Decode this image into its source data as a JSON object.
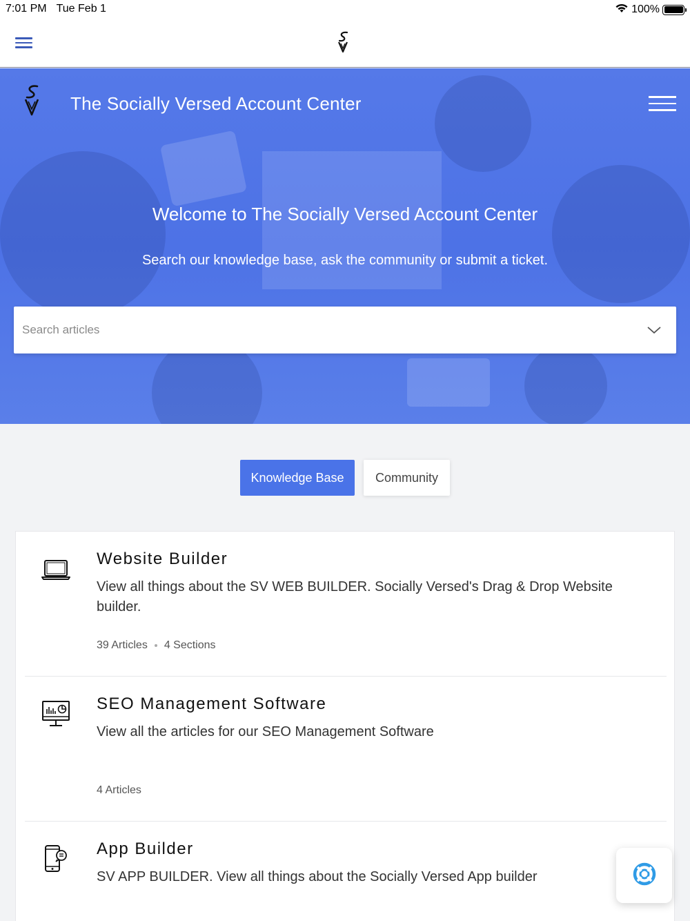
{
  "status_bar": {
    "time": "7:01 PM",
    "date": "Tue Feb 1",
    "battery": "100%",
    "icons": [
      "wifi-icon",
      "battery-icon"
    ]
  },
  "app_nav": {
    "menu_icon": "hamburger-icon",
    "logo": "socially-versed-logo"
  },
  "hero": {
    "brand": "The Socially Versed Account Center",
    "title": "Welcome to The Socially Versed Account Center",
    "subtitle": "Search our knowledge base, ask the community or submit a ticket.",
    "accent_color": "#4d72e6"
  },
  "search": {
    "placeholder": "Search articles",
    "value": ""
  },
  "tabs": {
    "knowledge_base": "Knowledge Base",
    "community": "Community",
    "active": "knowledge_base"
  },
  "categories": [
    {
      "icon": "laptop-icon",
      "title": "Website Builder",
      "description": "View all things about the SV WEB BUILDER. Socially Versed's Drag & Drop Website builder.",
      "articles": "39 Articles",
      "sections": "4 Sections"
    },
    {
      "icon": "monitor-analytics-icon",
      "title": "SEO Management Software",
      "description": "View all the articles for our SEO Management Software",
      "articles": "4 Articles"
    },
    {
      "icon": "mobile-app-icon",
      "title": "App Builder",
      "description": "SV APP BUILDER. View all things about the Socially Versed App builder"
    }
  ],
  "help_button": {
    "icon": "lifebuoy-icon",
    "color": "#2f9be6"
  }
}
